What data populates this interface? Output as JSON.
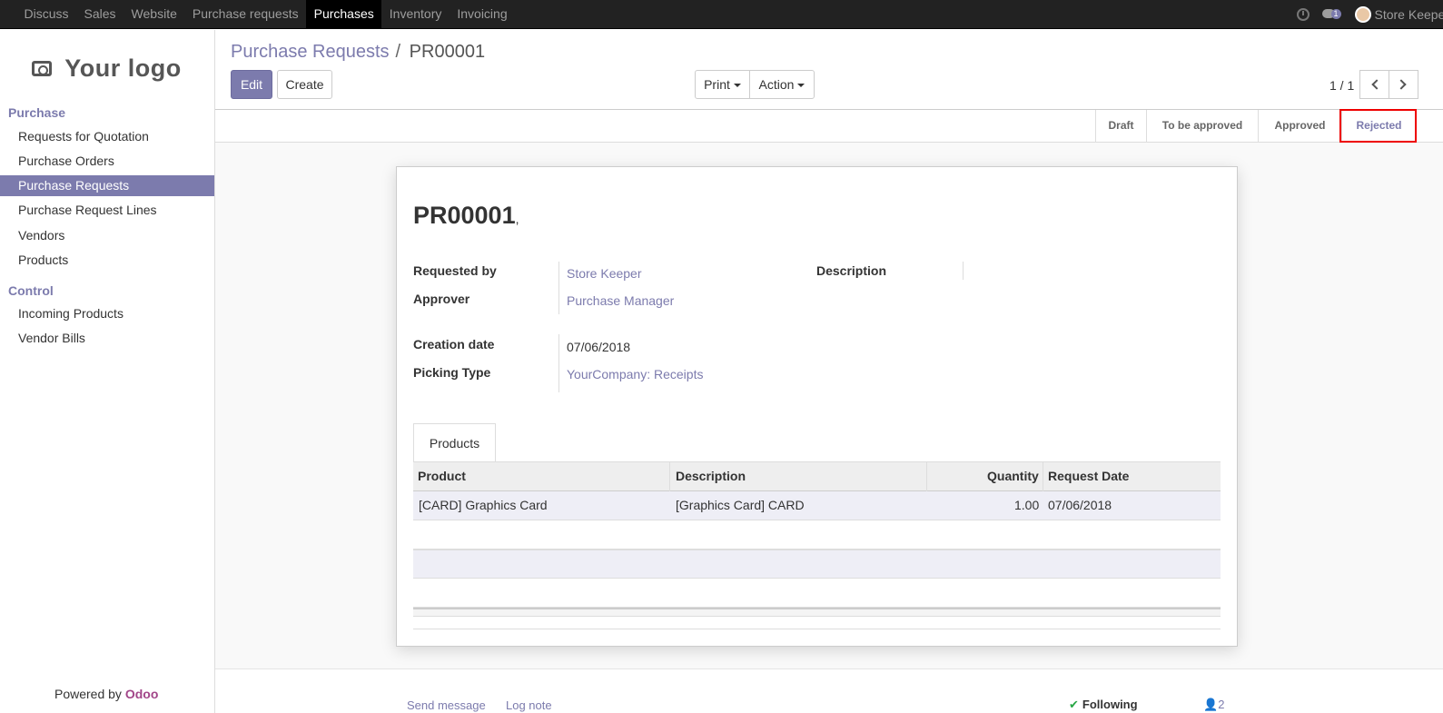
{
  "topbar": {
    "menu": [
      "Discuss",
      "Sales",
      "Website",
      "Purchase requests",
      "Purchases",
      "Inventory",
      "Invoicing"
    ],
    "active": "Purchases",
    "chat_badge": "1",
    "user": "Store Keeper"
  },
  "sidebar": {
    "logo": "Your logo",
    "sections": [
      {
        "title": "Purchase",
        "items": [
          "Requests for Quotation",
          "Purchase Orders",
          "Purchase Requests",
          "Purchase Request Lines",
          "Vendors",
          "Products"
        ]
      },
      {
        "title": "Control",
        "items": [
          "Incoming Products",
          "Vendor Bills"
        ]
      }
    ],
    "active_item": "Purchase Requests",
    "powered_by": "Powered by",
    "powered_brand": "Odoo"
  },
  "control": {
    "breadcrumb_parent": "Purchase Requests",
    "breadcrumb_sep": "/",
    "breadcrumb_current": "PR00001",
    "edit": "Edit",
    "create": "Create",
    "print": "Print",
    "action": "Action",
    "pager": "1 / 1"
  },
  "status": {
    "stages": [
      "Draft",
      "To be approved",
      "Approved",
      "Rejected"
    ],
    "current": "Rejected"
  },
  "form": {
    "name": "PR00001",
    "name_suffix": ",",
    "requested_by_label": "Requested by",
    "requested_by": "Store Keeper",
    "approver_label": "Approver",
    "approver": "Purchase Manager",
    "description_label": "Description",
    "description": "",
    "creation_date_label": "Creation date",
    "creation_date": "07/06/2018",
    "picking_type_label": "Picking Type",
    "picking_type": "YourCompany: Receipts",
    "tab": "Products",
    "columns": [
      "Product",
      "Description",
      "Quantity",
      "Request Date"
    ],
    "rows": [
      {
        "product": "[CARD] Graphics Card",
        "description": "[Graphics Card] CARD",
        "quantity": "1.00",
        "date": "07/06/2018"
      }
    ]
  },
  "chatter": {
    "send": "Send message",
    "log": "Log note",
    "following": "Following",
    "followers": "2"
  }
}
